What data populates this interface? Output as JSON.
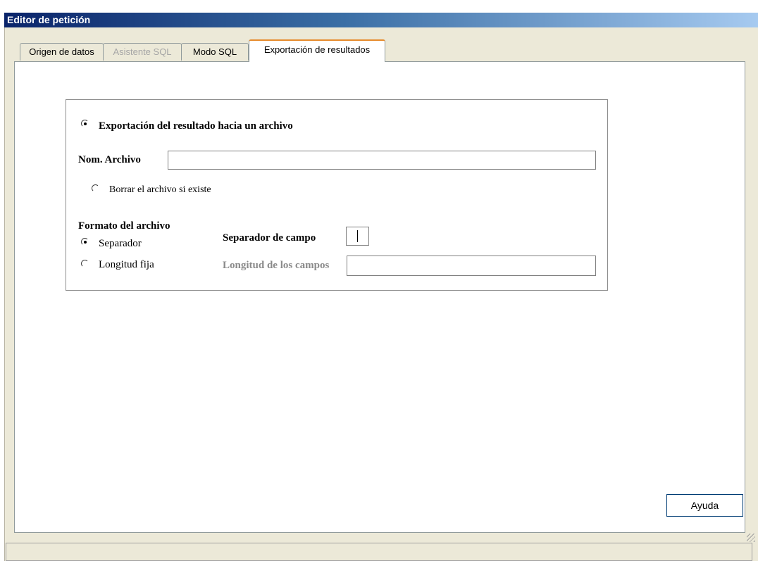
{
  "window": {
    "title": "Editor de petición"
  },
  "tabs": [
    {
      "label": "Origen de datos",
      "state": "normal"
    },
    {
      "label": "Asistente SQL",
      "state": "disabled"
    },
    {
      "label": "Modo SQL",
      "state": "normal"
    },
    {
      "label": "Exportación de resultados",
      "state": "active"
    }
  ],
  "export": {
    "export_option_label": "Exportación del resultado hacia un archivo",
    "export_option_checked": true,
    "filename_label": "Nom. Archivo",
    "filename_value": "",
    "delete_if_exists_label": "Borrar el archivo si existe",
    "delete_if_exists_checked": false,
    "format_heading": "Formato del archivo",
    "format_separator_label": "Separador",
    "format_separator_checked": true,
    "format_fixed_label": "Longitud fija",
    "format_fixed_checked": false,
    "field_separator_label": "Separador de campo",
    "field_separator_value": "",
    "field_length_label": "Longitud de los campos",
    "field_length_value": ""
  },
  "buttons": {
    "help_label": "Ayuda"
  }
}
